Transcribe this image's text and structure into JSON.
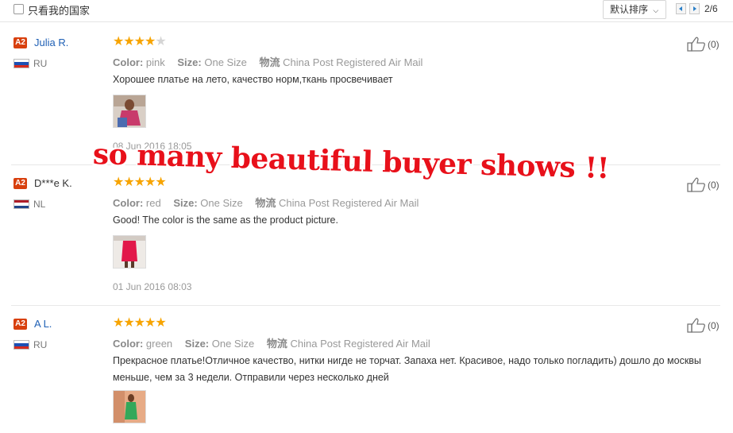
{
  "filter": {
    "only_my_country": "只看我的国家"
  },
  "sort": {
    "label": "默认排序"
  },
  "pagination": {
    "current": "2/6"
  },
  "attr_labels": {
    "color": "Color:",
    "size": "Size:",
    "shipping": "物流"
  },
  "reviews": [
    {
      "badge": "A2",
      "name": "Julia R.",
      "country": "RU",
      "stars": 4,
      "color": "pink",
      "size": "One Size",
      "shipping": "China Post Registered Air Mail",
      "text": "Хорошее платье на лето, качество норм,ткань просвечивает",
      "date": "08 Jun 2016 18:05",
      "likes": "(0)"
    },
    {
      "badge": "A2",
      "name": "D***e K.",
      "country": "NL",
      "stars": 5,
      "color": "red",
      "size": "One Size",
      "shipping": "China Post Registered Air Mail",
      "text": "Good! The color is the same as the product picture.",
      "date": "01 Jun 2016 08:03",
      "likes": "(0)"
    },
    {
      "badge": "A2",
      "name": "A L.",
      "country": "RU",
      "stars": 5,
      "color": "green",
      "size": "One Size",
      "shipping": "China Post Registered Air Mail",
      "text": "Прекрасное платье!Отличное качество, нитки нигде не торчат. Запаха нет. Красивое, надо только погладить) дошло до москвы меньше, чем за 3 недели. Отправили через несколько дней",
      "likes": "(0)"
    }
  ],
  "banner": "so many beautiful buyer shows !!",
  "colors": {
    "star": "#f7a400",
    "badge": "#d8400e",
    "name_link": "#1f60b5",
    "banner": "#e8101a"
  }
}
